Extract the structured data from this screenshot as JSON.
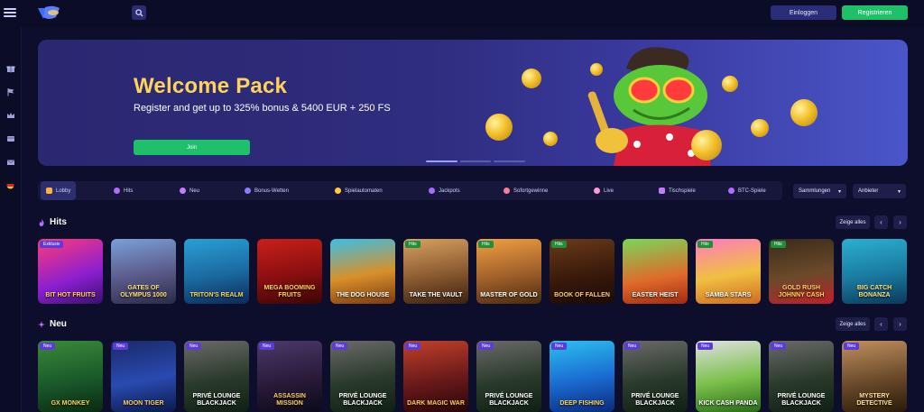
{
  "header": {
    "login_label": "Einloggen",
    "register_label": "Registrieren"
  },
  "sidebar": {
    "icons": [
      "gift-icon",
      "flag-icon",
      "crown-icon",
      "card-icon",
      "mail-icon",
      "german-flag-icon"
    ]
  },
  "banner": {
    "title": "Welcome Pack",
    "subtitle": "Register and get up to 325% bonus & 5400 EUR + 250 FS",
    "cta_label": "Join"
  },
  "categories": [
    {
      "label": "Lobby",
      "icon": "lobby-icon"
    },
    {
      "label": "Hits",
      "icon": "flame-icon"
    },
    {
      "label": "Neu",
      "icon": "sparkle-icon"
    },
    {
      "label": "Bonus-Wetten",
      "icon": "bonus-icon"
    },
    {
      "label": "Spielautomaten",
      "icon": "slot-icon"
    },
    {
      "label": "Jackpots",
      "icon": "jackpot-icon"
    },
    {
      "label": "Sofortgewinne",
      "icon": "rocket-icon"
    },
    {
      "label": "Live",
      "icon": "live-icon"
    },
    {
      "label": "Tischspiele",
      "icon": "table-icon"
    },
    {
      "label": "BTC-Spiele",
      "icon": "btc-icon"
    }
  ],
  "filters": {
    "collections_label": "Sammlungen",
    "providers_label": "Anbieter"
  },
  "sections": {
    "hits": {
      "title": "Hits",
      "show_all": "Zeige alles",
      "games": [
        {
          "name": "BIT HOT FRUITS",
          "badge": "Exklusiv"
        },
        {
          "name": "GATES OF OLYMPUS 1000",
          "badge": ""
        },
        {
          "name": "TRITON'S REALM",
          "badge": ""
        },
        {
          "name": "MEGA BOOMING FRUITS",
          "badge": ""
        },
        {
          "name": "THE DOG HOUSE",
          "badge": ""
        },
        {
          "name": "TAKE THE VAULT",
          "badge": "Hits"
        },
        {
          "name": "MASTER OF GOLD",
          "badge": "Hits"
        },
        {
          "name": "BOOK OF FALLEN",
          "badge": "Hits"
        },
        {
          "name": "EASTER HEIST",
          "badge": ""
        },
        {
          "name": "SAMBA STARS",
          "badge": "Hits"
        },
        {
          "name": "GOLD RUSH JOHNNY CASH",
          "badge": "Hits"
        },
        {
          "name": "BIG CATCH BONANZA",
          "badge": ""
        }
      ]
    },
    "neu": {
      "title": "Neu",
      "show_all": "Zeige alles",
      "games": [
        {
          "name": "GX MONKEY",
          "badge": "Neu"
        },
        {
          "name": "MOON TIGER",
          "badge": "Neu"
        },
        {
          "name": "PRIVÉ LOUNGE BLACKJACK",
          "badge": "Neu"
        },
        {
          "name": "ASSASSIN MISSION",
          "badge": "Neu"
        },
        {
          "name": "PRIVÉ LOUNGE BLACKJACK",
          "badge": "Neu"
        },
        {
          "name": "DARK MAGIC WAR",
          "badge": "Neu"
        },
        {
          "name": "PRIVÉ LOUNGE BLACKJACK",
          "badge": "Neu"
        },
        {
          "name": "DEEP FISHING",
          "badge": "Neu"
        },
        {
          "name": "PRIVÉ LOUNGE BLACKJACK",
          "badge": "Neu"
        },
        {
          "name": "KICK CASH PANDA",
          "badge": "Neu"
        },
        {
          "name": "PRIVÉ LOUNGE BLACKJACK",
          "badge": "Neu"
        },
        {
          "name": "MYSTERY DETECTIVE",
          "badge": "Neu"
        }
      ]
    }
  }
}
